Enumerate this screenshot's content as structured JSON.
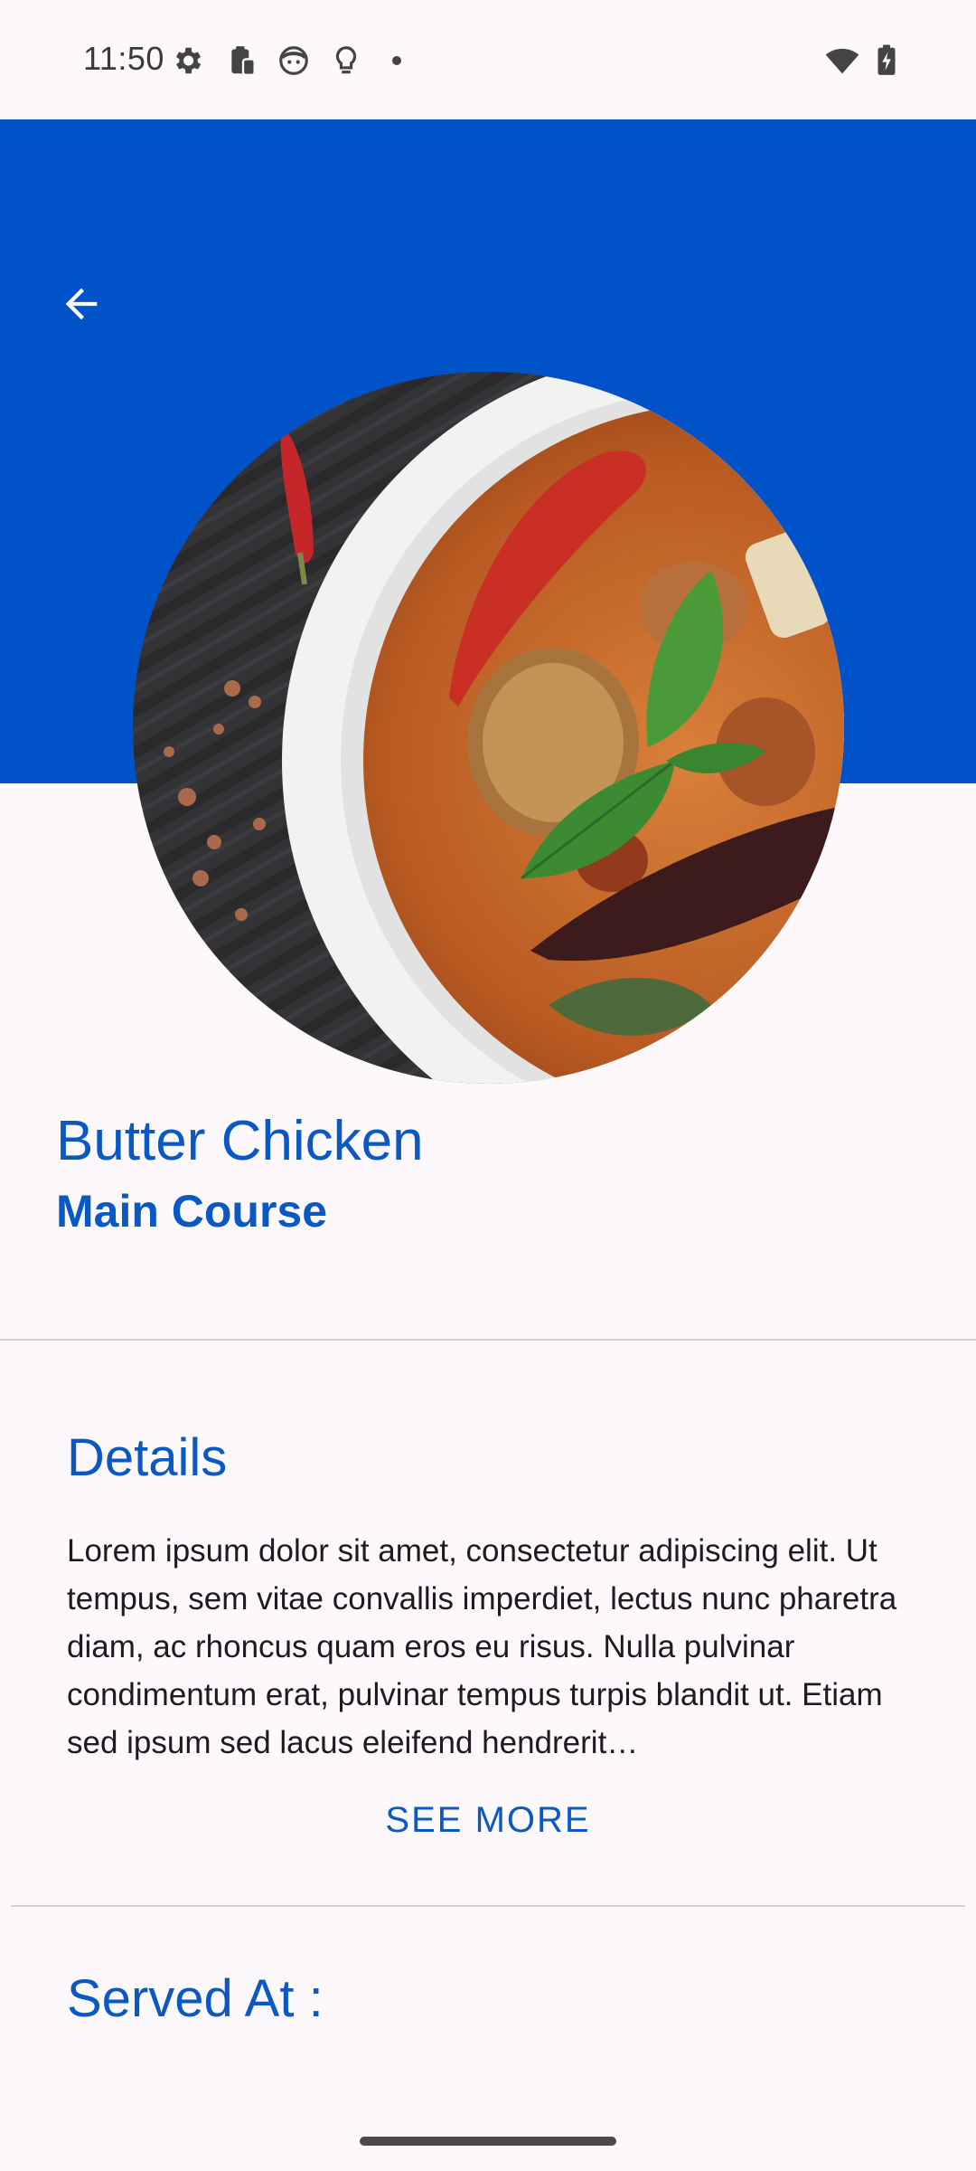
{
  "status_bar": {
    "time": "11:50",
    "left_icons": [
      "gear-icon",
      "clipboard-icon",
      "face-icon",
      "lightbulb-icon",
      "notification-dot"
    ],
    "right_icons": [
      "wifi-icon",
      "battery-charging-icon"
    ]
  },
  "colors": {
    "header_background": "#0052c8",
    "accent_text": "#0a58c4",
    "page_background": "#fcf8fc"
  },
  "header": {
    "back_icon": "arrow-back-icon",
    "hero_image": "curry dish photo"
  },
  "dish": {
    "name": "Butter Chicken",
    "category": "Main Course"
  },
  "details": {
    "heading": "Details",
    "body": "Lorem ipsum dolor sit amet, consectetur adipiscing elit. Ut tempus, sem vitae convallis imperdiet, lectus nunc pharetra diam, ac rhoncus quam eros eu risus. Nulla pulvinar condimentum erat, pulvinar tempus turpis blandit ut. Etiam sed ipsum sed lacus eleifend hendrerit…",
    "see_more_label": "SEE MORE"
  },
  "served_at": {
    "heading": "Served At :"
  }
}
